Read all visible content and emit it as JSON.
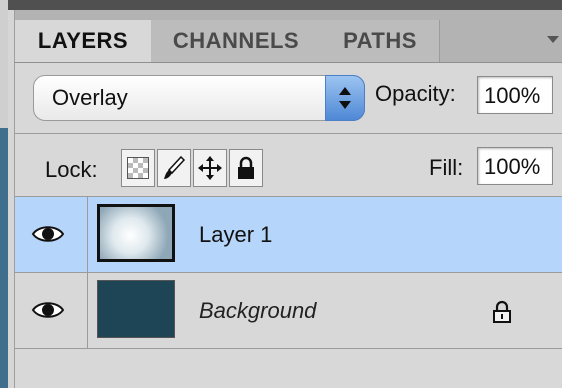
{
  "tabs": [
    "LAYERS",
    "CHANNELS",
    "PATHS"
  ],
  "blend_mode": "Overlay",
  "opacity": {
    "label": "Opacity:",
    "value": "100%"
  },
  "lock": {
    "label": "Lock:"
  },
  "fill": {
    "label": "Fill:",
    "value": "100%"
  },
  "layers": [
    {
      "name": "Layer 1",
      "selected": true,
      "visible": true
    },
    {
      "name": "Background",
      "selected": false,
      "visible": true,
      "locked": true
    }
  ],
  "colors": {
    "selection": "#b6d5fb",
    "background_swatch": "#1d4555",
    "select_arrows": "#4f88d6"
  }
}
